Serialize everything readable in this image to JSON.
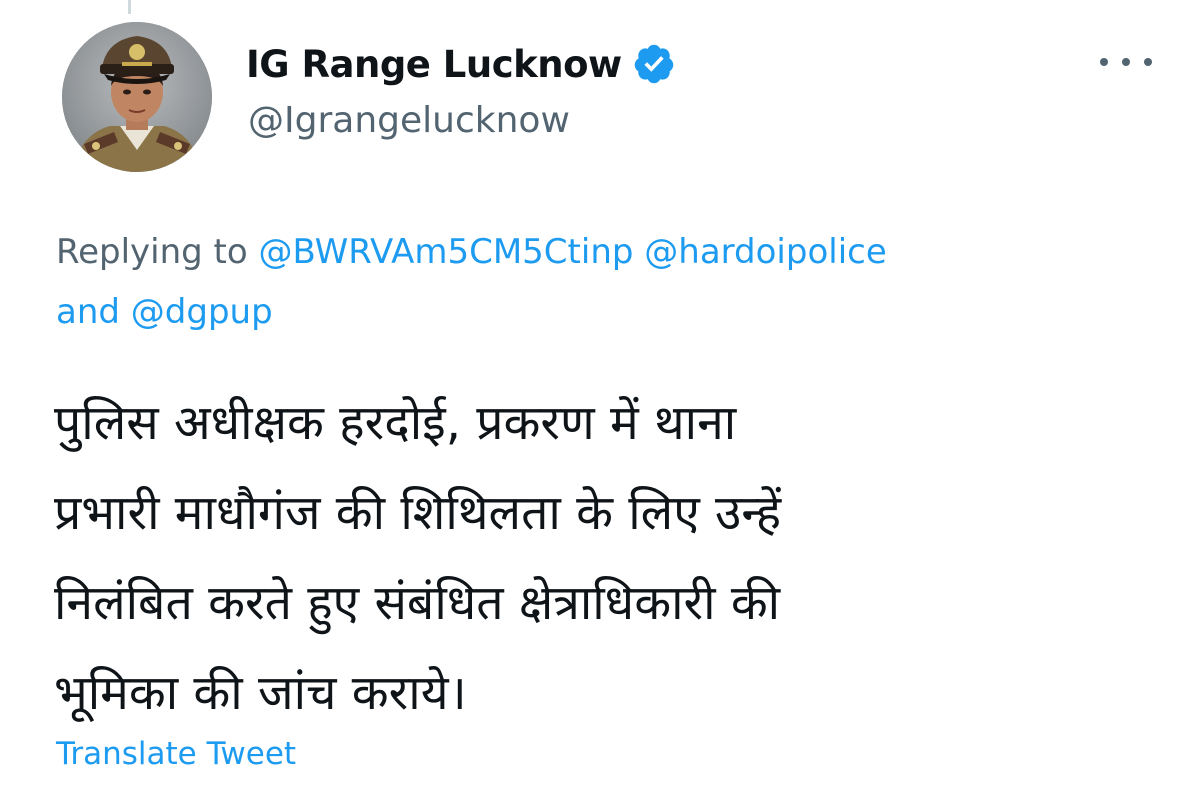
{
  "colors": {
    "text_primary": "#0f1419",
    "text_secondary": "#536471",
    "accent_blue": "#1d9bf0",
    "background": "#ffffff"
  },
  "author": {
    "display_name": "IG Range Lucknow",
    "handle": "@Igrangelucknow",
    "verified": true,
    "verified_icon": "verified-badge-icon",
    "avatar_icon": "profile-photo"
  },
  "menu": {
    "more_icon": "more-options-icon"
  },
  "reply": {
    "prefix": "Replying to",
    "mentions": [
      "@BWRVAm5CM5Ctinp",
      "@hardoipolice",
      "@dgpup"
    ],
    "conjunction": "and"
  },
  "tweet": {
    "lines": [
      "पुलिस अधीक्षक हरदोई, प्रकरण में थाना",
      "प्रभारी माधौगंज की शिथिलता के लिए उन्हें",
      "निलंबित करते हुए संबंधित क्षेत्राधिकारी की",
      "भूमिका की जांच कराये।"
    ]
  },
  "translate": {
    "label": "Translate Tweet"
  }
}
